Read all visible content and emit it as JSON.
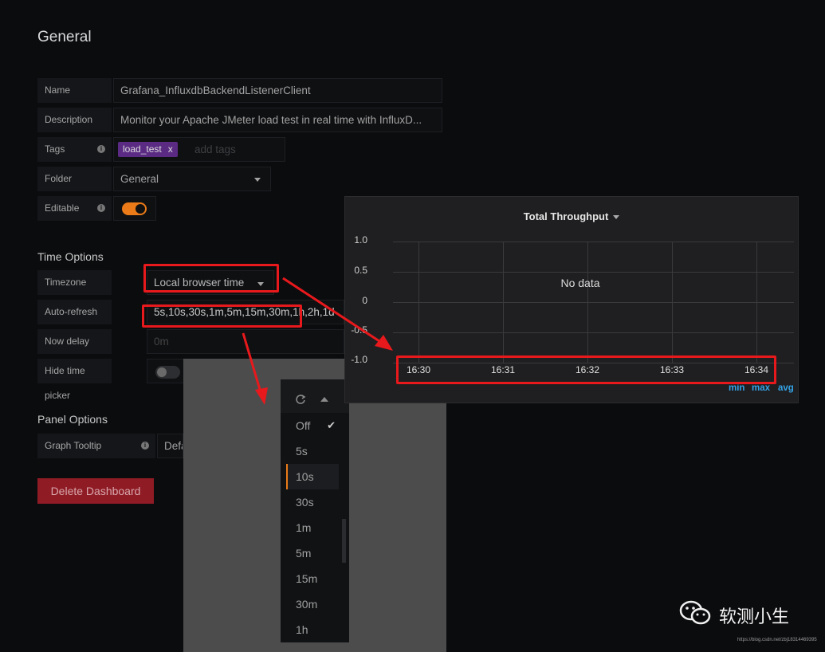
{
  "general": {
    "title": "General",
    "name_label": "Name",
    "name_value": "Grafana_InfluxdbBackendListenerClient",
    "description_label": "Description",
    "description_value": "Monitor your Apache JMeter load test in real time with InfluxD...",
    "tags_label": "Tags",
    "tag_value": "load_test",
    "tag_remove": "x",
    "tags_placeholder": "add tags",
    "folder_label": "Folder",
    "folder_value": "General",
    "editable_label": "Editable",
    "editable_on": true
  },
  "time_options": {
    "title": "Time Options",
    "timezone_label": "Timezone",
    "timezone_value": "Local browser time",
    "autorefresh_label": "Auto-refresh",
    "autorefresh_value": "5s,10s,30s,1m,5m,15m,30m,1h,2h,1d",
    "nowdelay_label": "Now delay now-",
    "nowdelay_placeholder": "0m",
    "hidepicker_label": "Hide time picker",
    "hidepicker_on": false
  },
  "panel_options": {
    "title": "Panel Options",
    "tooltip_label": "Graph Tooltip",
    "tooltip_value": "Defa"
  },
  "delete_label": "Delete Dashboard",
  "graph": {
    "title": "Total Throughput",
    "no_data": "No data",
    "yticks": [
      "1.0",
      "0.5",
      "0",
      "-0.5",
      "-1.0"
    ],
    "xticks": [
      "16:30",
      "16:31",
      "16:32",
      "16:33",
      "16:34"
    ],
    "legend": [
      "min",
      "max",
      "avg"
    ],
    "legend_color": "#33a2e5"
  },
  "refresh_menu": {
    "items": [
      "Off",
      "5s",
      "10s",
      "30s",
      "1m",
      "5m",
      "15m",
      "30m",
      "1h"
    ],
    "checked": "Off",
    "highlighted": "10s",
    "accent": "#eb7b18"
  },
  "watermark": {
    "text": "软测小生",
    "url": "https://blog.csdn.net/zbj18314469395"
  },
  "colors": {
    "background": "#0b0c0e",
    "toggle_on": "#eb7b18",
    "annotation": "#e8191c",
    "danger": "#8f1b25"
  }
}
